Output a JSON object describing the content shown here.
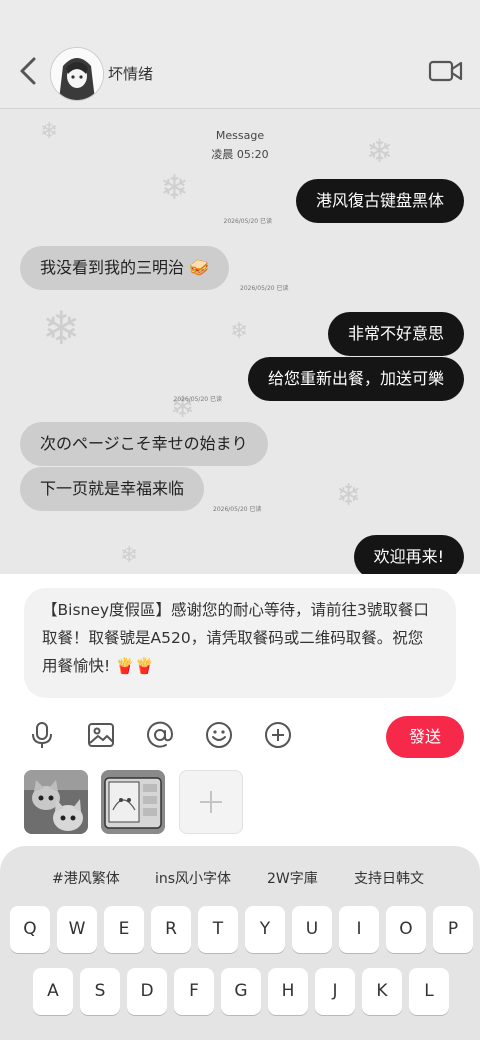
{
  "header": {
    "contact_name": "坏情绪"
  },
  "chat": {
    "head_label": "Message",
    "head_time": "凌晨  05:20",
    "messages": [
      {
        "text": "港风復古键盘黑体",
        "status": "2026/05/20  已读"
      },
      {
        "text": "我没看到我的三明治 🥪",
        "status": "2026/05/20  已读"
      },
      {
        "text": "非常不好意思"
      },
      {
        "text": "给您重新出餐，加送可樂",
        "status": "2026/05/20  已读"
      },
      {
        "text": "次のページこそ幸せの始まり"
      },
      {
        "text": "下一页就是幸福来临",
        "status": "2026/05/20  已读"
      },
      {
        "text": "欢迎再来!"
      }
    ]
  },
  "composer": {
    "text": "【Bisney度假區】感谢您的耐心等待，请前往3號取餐口取餐！取餐號是A520，请凭取餐码或二维码取餐。祝您用餐愉快! 🍟🍟",
    "send_label": "發送"
  },
  "toolbar": {
    "icons": [
      "microphone-icon",
      "image-icon",
      "mention-icon",
      "emoji-icon",
      "add-icon"
    ]
  },
  "keyboard": {
    "suggestions": [
      "#港风繁体",
      "ins风小字体",
      "2W字庫",
      "支持日韩文"
    ],
    "row1": [
      "Q",
      "W",
      "E",
      "R",
      "T",
      "Y",
      "U",
      "I",
      "O",
      "P"
    ],
    "row2": [
      "A",
      "S",
      "D",
      "F",
      "G",
      "H",
      "J",
      "K",
      "L"
    ]
  },
  "colors": {
    "send": "#f7294a",
    "outgoing_bubble": "#151515",
    "incoming_bubble": "#cdcdcd"
  }
}
